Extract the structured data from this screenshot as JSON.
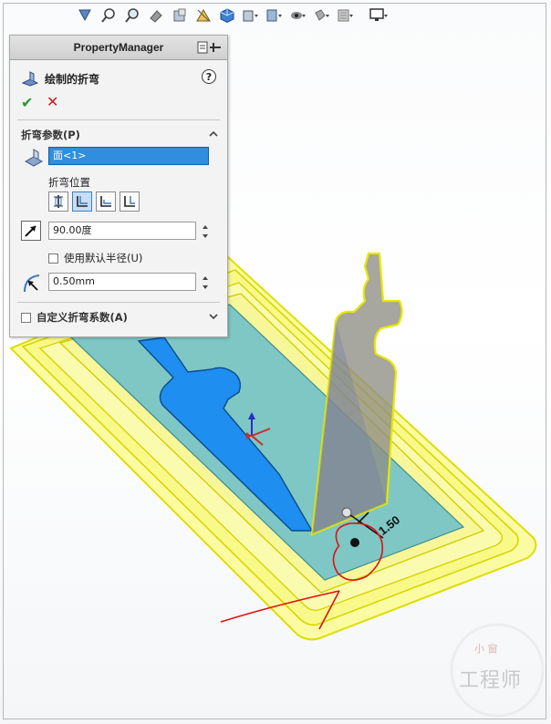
{
  "property_manager": {
    "header_title": "PropertyManager",
    "feature_title": "绘制的折弯",
    "help_label": "?",
    "ok_glyph": "✔",
    "cancel_glyph": "✕",
    "bend_params": {
      "section_title": "折弯参数(P)",
      "face_selection": "面<1>",
      "bend_position_label": "折弯位置",
      "bend_position_options": [
        "bend-centerline",
        "material-inside",
        "material-outside",
        "bend-outside"
      ],
      "selected_bend_position_index": 1,
      "angle_value": "90.00度",
      "use_default_radius_label": "使用默认半径(U)",
      "use_default_radius_checked": false,
      "radius_value": "0.50mm"
    },
    "custom_bend_allowance": {
      "section_title": "自定义折弯系数(A)",
      "checked": false
    }
  },
  "viewport": {
    "dimension_label": "1.50",
    "hud_icons": [
      "view-orientation-icon",
      "zoom-to-fit-icon",
      "zoom-area-icon",
      "previous-view-icon",
      "section-view-icon",
      "dynamic-annotation-icon",
      "view-cube-icon",
      "display-style-icon",
      "hide-show-icon",
      "edit-appearance-icon",
      "apply-scene-icon",
      "view-settings-icon",
      "monitor-icon"
    ]
  },
  "watermark": {
    "text": "工程师",
    "small": "小 窗"
  },
  "colors": {
    "face_fill": "#1e8ef0",
    "teal_plate": "#7ec7c4",
    "yellow_highlight": "#f4f000",
    "annotation_red": "#e01010",
    "selection_blue": "#2f8fde"
  }
}
